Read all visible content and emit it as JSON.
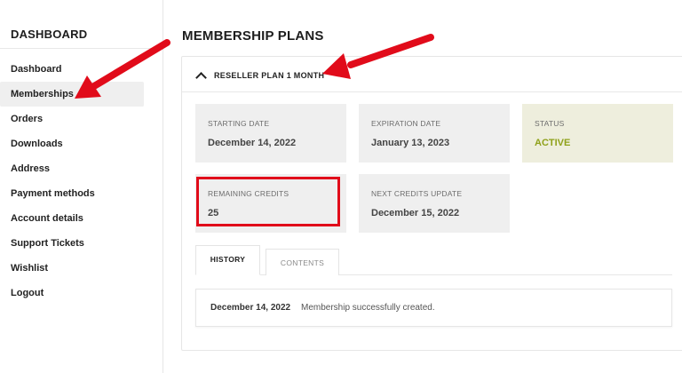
{
  "sidebar": {
    "title": "DASHBOARD",
    "items": [
      {
        "label": "Dashboard",
        "active": false
      },
      {
        "label": "Memberships",
        "active": true
      },
      {
        "label": "Orders",
        "active": false
      },
      {
        "label": "Downloads",
        "active": false
      },
      {
        "label": "Address",
        "active": false
      },
      {
        "label": "Payment methods",
        "active": false
      },
      {
        "label": "Account details",
        "active": false
      },
      {
        "label": "Support Tickets",
        "active": false
      },
      {
        "label": "Wishlist",
        "active": false
      },
      {
        "label": "Logout",
        "active": false
      }
    ]
  },
  "main": {
    "title": "MEMBERSHIP PLANS",
    "plan": {
      "name": "RESELLER PLAN 1 MONTH",
      "starting_date_label": "STARTING DATE",
      "starting_date": "December 14, 2022",
      "expiration_date_label": "EXPIRATION DATE",
      "expiration_date": "January 13, 2023",
      "status_label": "STATUS",
      "status": "ACTIVE",
      "remaining_credits_label": "REMAINING CREDITS",
      "remaining_credits": "25",
      "next_update_label": "NEXT CREDITS UPDATE",
      "next_update": "December 15, 2022"
    },
    "tabs": [
      {
        "label": "HISTORY",
        "active": true
      },
      {
        "label": "CONTENTS",
        "active": false
      }
    ],
    "history": [
      {
        "date": "December 14, 2022",
        "text": "Membership successfully created."
      }
    ]
  },
  "colors": {
    "status_active": "#8fa11a",
    "annotation_red": "#e10b1a",
    "card_bg": "#efefef",
    "status_bg": "#eeeedd"
  }
}
